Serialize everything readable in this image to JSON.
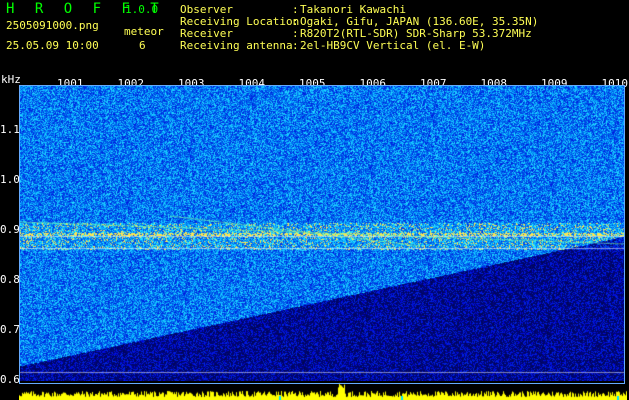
{
  "header": {
    "app_title": "H R O F F T",
    "app_version": "1.0.0",
    "filename": "2505091000.png",
    "datetime": "25.05.09 10:00",
    "meteor_label": "meteor",
    "meteor_count": "6",
    "info": [
      {
        "label": "Observer",
        "value": "Takanori Kawachi"
      },
      {
        "label": "Receiving Location",
        "value": "Ogaki, Gifu, JAPAN (136.60E, 35.35N)"
      },
      {
        "label": "Receiver",
        "value": "R820T2(RTL-SDR) SDR-Sharp 53.372MHz"
      },
      {
        "label": "Receiving antenna",
        "value": "2el-HB9CV Vertical (el. E-W)"
      }
    ]
  },
  "plot": {
    "y_unit": "kHz",
    "y_ticks": [
      "1.1",
      "1.0",
      "0.9",
      "0.8",
      "0.7",
      "0.6"
    ],
    "x_ticks": [
      "1001",
      "1002",
      "1003",
      "1004",
      "1005",
      "1006",
      "1007",
      "1008",
      "1009",
      "1010"
    ]
  },
  "colors": {
    "background": "#000000",
    "title_green": "#00ff00",
    "label_yellow": "#ffff55",
    "signal_yellow": "#ffff00",
    "spectrogram_dark": "#03003a",
    "spectrogram_blue": "#2050ff",
    "spectrogram_cyan": "#00e0ff"
  }
}
